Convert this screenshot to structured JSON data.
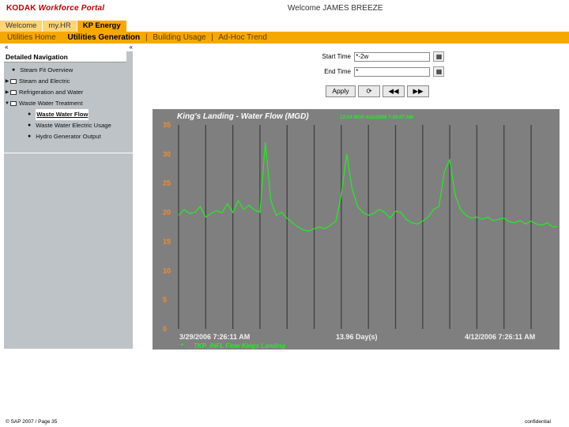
{
  "header": {
    "logo_brand": "KODAK",
    "logo_rest": " Workforce Portal",
    "welcome": "Welcome JAMES BREEZE"
  },
  "tabs": [
    {
      "label": "Welcome"
    },
    {
      "label": "my.HR"
    },
    {
      "label": "KP Energy"
    }
  ],
  "subnav": {
    "items": [
      "Utilities Home",
      "Utilities Generation",
      "Building Usage",
      "Ad-Hoc Trend"
    ],
    "separator": "|"
  },
  "sidebar": {
    "collapse_left": "«",
    "collapse_right": "«",
    "heading": "Detailed Navigation",
    "items": [
      {
        "label": "Steam Fit Overview"
      },
      {
        "label": "Steam and Electric"
      },
      {
        "label": "Refrigeration and Water"
      },
      {
        "label": "Waste Water Treatment"
      },
      {
        "label": "Waste Water Flow"
      },
      {
        "label": "Waste Water Electric Usage"
      },
      {
        "label": "Hydro Generator Output"
      }
    ]
  },
  "form": {
    "start_label": "Start Time",
    "start_value": "*-2w",
    "end_label": "End Time",
    "end_value": "*",
    "apply_label": "Apply",
    "colors": {
      "accent": "#f7a800",
      "tab_light": "#fcd577"
    }
  },
  "chart_data": {
    "type": "line",
    "title": "King's Landing - Water Flow (MGD)",
    "timestamp_label": "13:24 MGD 4/12/2006 7:26:07 AM",
    "ylim": [
      0,
      35
    ],
    "yticks": [
      0,
      5,
      10,
      15,
      20,
      25,
      30,
      35
    ],
    "x_start_label": "3/29/2006 7:26:11 AM",
    "x_span_label": "13.96 Day(s)",
    "x_end_label": "4/12/2006 7:26:11 AM",
    "series": [
      {
        "name": "TKP_INFL Flow Kings Landing",
        "color": "#22ee22",
        "days": [
          0,
          0.2,
          0.4,
          0.6,
          0.8,
          1.0,
          1.2,
          1.4,
          1.6,
          1.8,
          2.0,
          2.2,
          2.4,
          2.6,
          2.8,
          3.0,
          3.2,
          3.4,
          3.6,
          3.8,
          4.0,
          4.2,
          4.4,
          4.6,
          4.8,
          5.0,
          5.2,
          5.4,
          5.6,
          5.8,
          6.0,
          6.2,
          6.4,
          6.6,
          6.8,
          7.0,
          7.2,
          7.4,
          7.6,
          7.8,
          8.0,
          8.2,
          8.4,
          8.6,
          8.8,
          9.0,
          9.2,
          9.4,
          9.6,
          9.8,
          10.0,
          10.2,
          10.4,
          10.6,
          10.8,
          11.0,
          11.2,
          11.4,
          11.6,
          11.8,
          12.0,
          12.2,
          12.4,
          12.6,
          12.8,
          13.0,
          13.2,
          13.4,
          13.6,
          13.8,
          13.96
        ],
        "values": [
          19.5,
          20.5,
          19.8,
          20.0,
          21.0,
          19.2,
          19.8,
          20.3,
          19.9,
          21.5,
          20.0,
          22.0,
          20.5,
          21.2,
          20.4,
          20.0,
          32.0,
          22.0,
          19.5,
          20.0,
          19.0,
          18.2,
          17.5,
          17.0,
          16.8,
          17.2,
          17.5,
          17.2,
          17.8,
          18.5,
          23.0,
          30.0,
          24.0,
          21.0,
          20.0,
          19.5,
          19.8,
          20.5,
          20.0,
          19.0,
          20.2,
          20.0,
          18.8,
          18.2,
          18.0,
          18.5,
          19.2,
          20.5,
          21.0,
          27.0,
          29.0,
          23.0,
          20.5,
          19.5,
          19.0,
          19.2,
          18.8,
          19.2,
          18.6,
          18.8,
          19.0,
          18.4,
          18.2,
          18.6,
          18.0,
          18.5,
          18.0,
          17.8,
          18.2,
          17.5,
          17.6
        ]
      }
    ],
    "grid": "vertical",
    "colors": {
      "background": "#7f7f7f",
      "grid": "#404040",
      "text": "#f0f0f0",
      "title": "#ffffff",
      "timestamp": "#22ee22",
      "series": "#22ee22"
    }
  },
  "footer": {
    "left": "© SAP 2007 / Page 35",
    "right": "confidential"
  }
}
